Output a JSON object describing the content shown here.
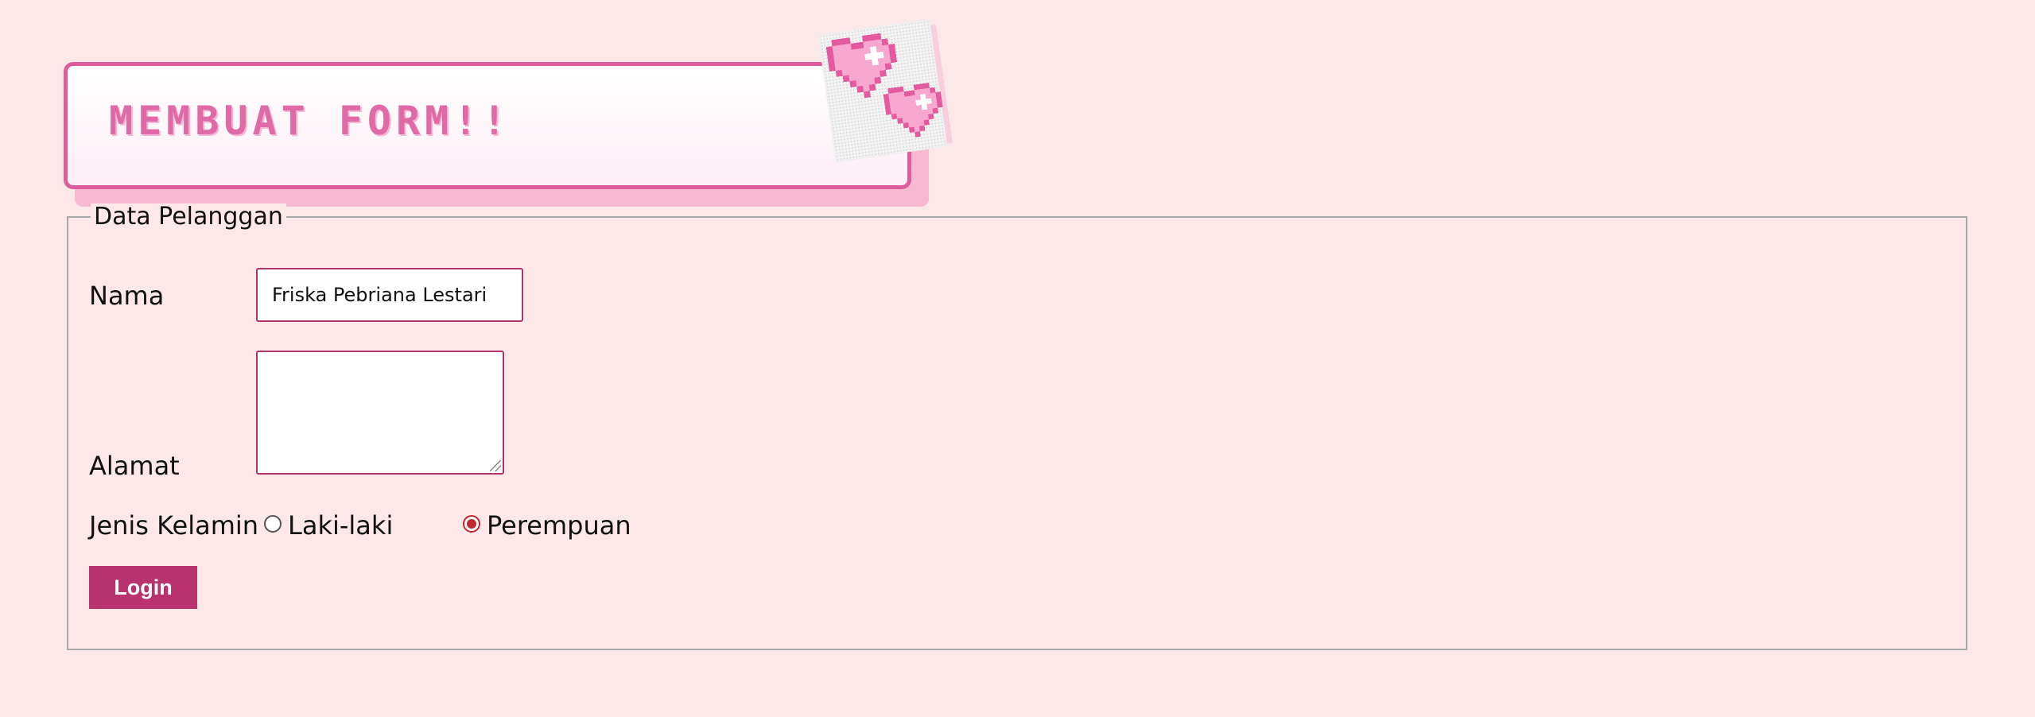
{
  "header": {
    "title": "MEMBUAT FORM!!",
    "decoration_icon": "pixel-hearts-icon",
    "colors": {
      "title": "#e06aa6",
      "border": "#dc5c9c",
      "shadow": "#f7b8d1",
      "heart": "#f18cc0"
    }
  },
  "form": {
    "legend": "Data Pelanggan",
    "fields": {
      "nama": {
        "label": "Nama",
        "value": "Friska Pebriana Lestari"
      },
      "alamat": {
        "label": "Alamat",
        "value": ""
      },
      "jenis_kelamin": {
        "label": "Jenis Kelamin",
        "options": [
          {
            "label": "Laki-laki",
            "checked": false
          },
          {
            "label": "Perempuan",
            "checked": true
          }
        ]
      }
    },
    "submit_label": "Login",
    "colors": {
      "page_background": "#fce8e8",
      "input_border": "#b0336a",
      "button": "#b8326e",
      "radio_checked": "#c2282f"
    }
  }
}
